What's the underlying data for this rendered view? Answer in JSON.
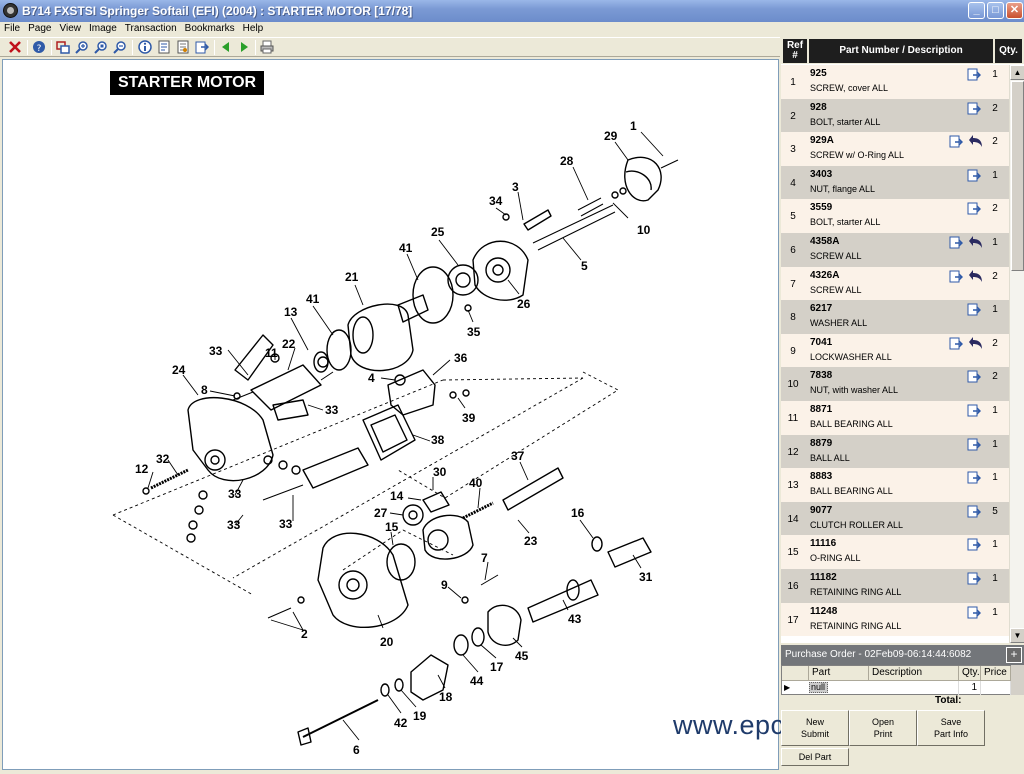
{
  "window": {
    "title": "B714 FXSTSI Springer Softail (EFI) (2004) : STARTER MOTOR [17/78]",
    "min_label": "_",
    "max_label": "□",
    "close_label": "✕"
  },
  "menu": [
    "File",
    "Page",
    "View",
    "Image",
    "Transaction",
    "Bookmarks",
    "Help"
  ],
  "toolbar_icons": [
    "close-icon",
    "help-icon",
    "print-preview-icon",
    "zoom-in-icon",
    "zoom-fit-icon",
    "zoom-out-icon",
    "info-icon",
    "document-icon",
    "document-list-icon",
    "export-icon",
    "back-arrow-icon",
    "forward-arrow-icon",
    "print-icon"
  ],
  "diagram": {
    "title": "STARTER MOTOR",
    "callouts": [
      "1",
      "29",
      "28",
      "10",
      "3",
      "34",
      "25",
      "41",
      "26",
      "5",
      "21",
      "41",
      "13",
      "35",
      "33",
      "22",
      "11",
      "36",
      "24",
      "8",
      "4",
      "39",
      "33",
      "38",
      "12",
      "32",
      "33",
      "30",
      "37",
      "33",
      "14",
      "40",
      "33",
      "27",
      "15",
      "23",
      "16",
      "7",
      "9",
      "31",
      "20",
      "2",
      "45",
      "43",
      "17",
      "44",
      "18",
      "42",
      "19",
      "6"
    ]
  },
  "watermark": "www.epcatalogs.com",
  "parts_header": {
    "ref": "Ref #",
    "part": "Part Number / Description",
    "qty": "Qty."
  },
  "parts": [
    {
      "ref": "1",
      "number": "925",
      "desc": "SCREW, cover ALL",
      "qty": "1",
      "has_back": false
    },
    {
      "ref": "2",
      "number": "928",
      "desc": "BOLT, starter ALL",
      "qty": "2",
      "has_back": false
    },
    {
      "ref": "3",
      "number": "929A",
      "desc": "SCREW w/ O-Ring ALL",
      "qty": "2",
      "has_back": true
    },
    {
      "ref": "4",
      "number": "3403",
      "desc": "NUT, flange ALL",
      "qty": "1",
      "has_back": false
    },
    {
      "ref": "5",
      "number": "3559",
      "desc": "BOLT, starter ALL",
      "qty": "2",
      "has_back": false
    },
    {
      "ref": "6",
      "number": "4358A",
      "desc": "SCREW ALL",
      "qty": "1",
      "has_back": true
    },
    {
      "ref": "7",
      "number": "4326A",
      "desc": "SCREW ALL",
      "qty": "2",
      "has_back": true
    },
    {
      "ref": "8",
      "number": "6217",
      "desc": "WASHER ALL",
      "qty": "1",
      "has_back": false
    },
    {
      "ref": "9",
      "number": "7041",
      "desc": "LOCKWASHER ALL",
      "qty": "2",
      "has_back": true
    },
    {
      "ref": "10",
      "number": "7838",
      "desc": "NUT, with washer ALL",
      "qty": "2",
      "has_back": false
    },
    {
      "ref": "11",
      "number": "8871",
      "desc": "BALL BEARING ALL",
      "qty": "1",
      "has_back": false
    },
    {
      "ref": "12",
      "number": "8879",
      "desc": "BALL ALL",
      "qty": "1",
      "has_back": false
    },
    {
      "ref": "13",
      "number": "8883",
      "desc": "BALL BEARING ALL",
      "qty": "1",
      "has_back": false
    },
    {
      "ref": "14",
      "number": "9077",
      "desc": "CLUTCH ROLLER ALL",
      "qty": "5",
      "has_back": false
    },
    {
      "ref": "15",
      "number": "11116",
      "desc": "O-RING ALL",
      "qty": "1",
      "has_back": false
    },
    {
      "ref": "16",
      "number": "11182",
      "desc": "RETAINING RING ALL",
      "qty": "1",
      "has_back": false
    },
    {
      "ref": "17",
      "number": "11248",
      "desc": "RETAINING RING ALL",
      "qty": "1",
      "has_back": false
    }
  ],
  "purchase_order": {
    "title": "Purchase Order - 02Feb09-06:14:44:6082",
    "plus_label": "+",
    "columns": [
      "Part",
      "Description",
      "Qty.",
      "Price"
    ],
    "row": {
      "part": "null",
      "description": "",
      "qty": "1",
      "price": ""
    },
    "total_label": "Total:",
    "buttons": {
      "new": "New",
      "submit": "Submit",
      "open": "Open",
      "print": "Print",
      "save": "Save",
      "part_info": "Part Info",
      "del_part": "Del Part"
    }
  },
  "colors": {
    "accent_blue": "#2f5aa8",
    "titlebar": "#7b9ad4",
    "row_odd": "#fbf2e8",
    "row_even": "#d4d0c8"
  }
}
